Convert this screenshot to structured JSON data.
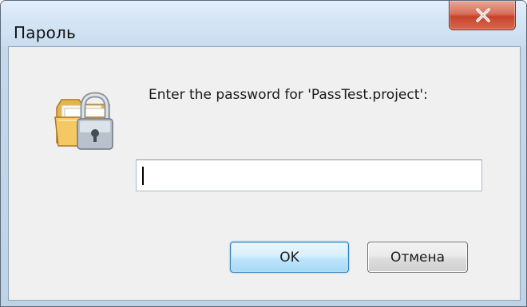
{
  "window": {
    "title": "Пароль",
    "close_icon": "close-x-icon",
    "accent_close": "#c7432b"
  },
  "dialog": {
    "icon": "locked-folder-icon",
    "prompt": "Enter the password for 'PassTest.project':",
    "password_value": "",
    "password_placeholder": ""
  },
  "buttons": {
    "ok_label": "OK",
    "cancel_label": "Отмена"
  }
}
